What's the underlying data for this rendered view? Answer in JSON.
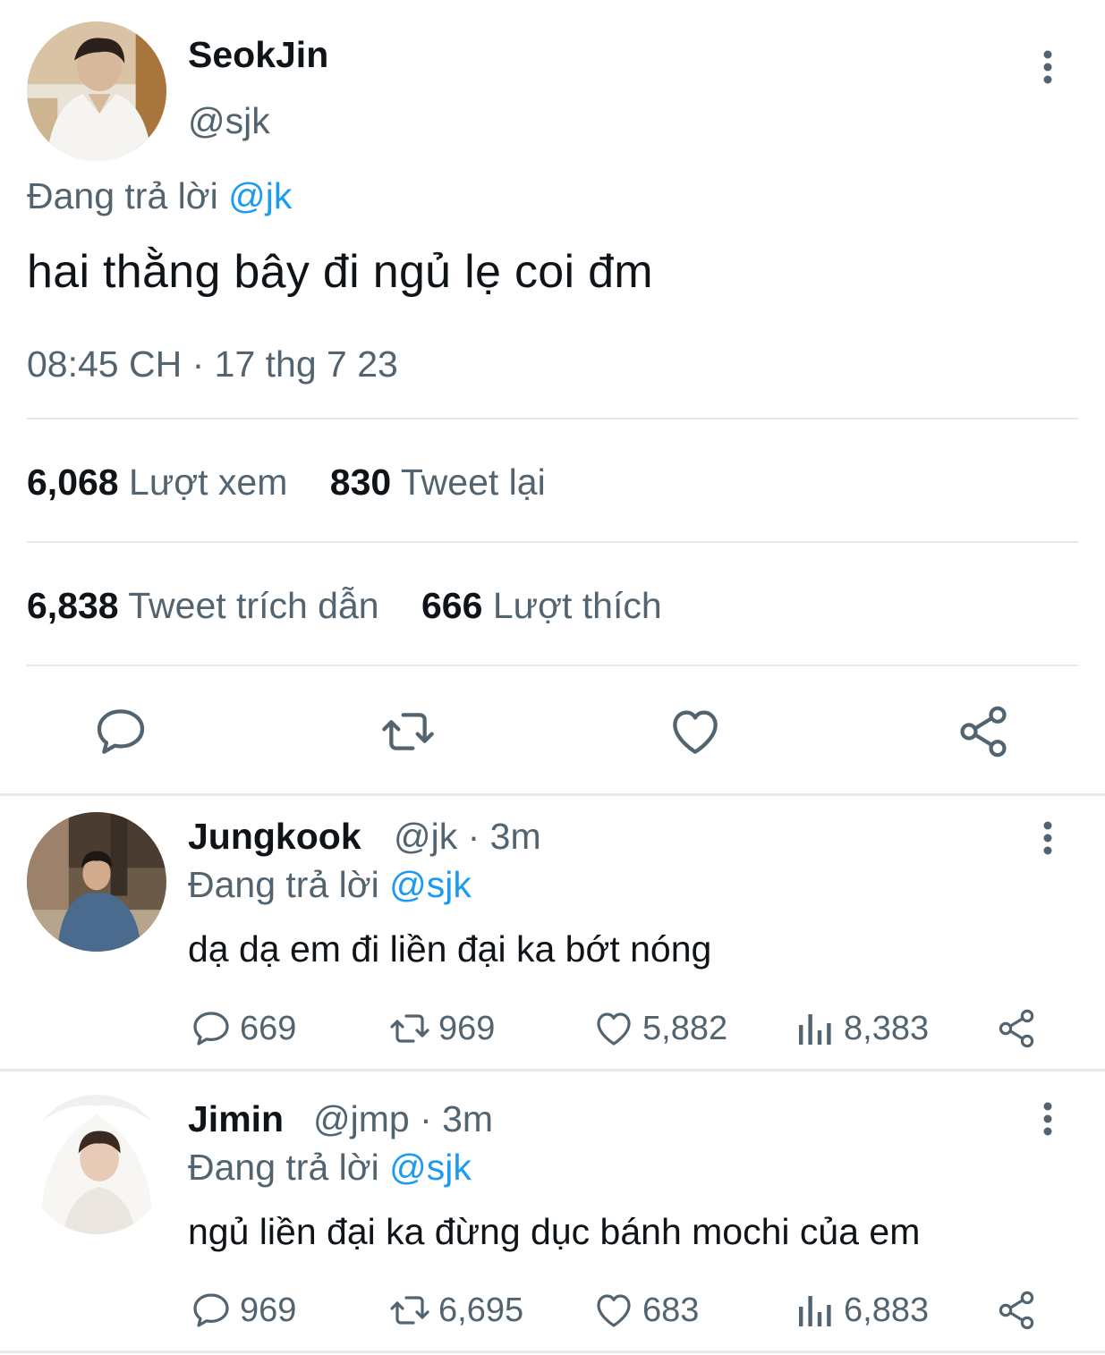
{
  "main_tweet": {
    "author": {
      "display_name": "SeokJin",
      "handle": "@sjk"
    },
    "reply_prefix": "Đang trả lời",
    "reply_to": "@jk",
    "text": "hai thằng bây đi ngủ lẹ coi đm",
    "timestamp": "08:45 CH · 17 thg 7 23",
    "stats": {
      "views_count": "6,068",
      "views_label": "Lượt xem",
      "retweets_count": "830",
      "retweets_label": "Tweet lại",
      "quotes_count": "6,838",
      "quotes_label": "Tweet trích dẫn",
      "likes_count": "666",
      "likes_label": "Lượt thích"
    },
    "actions": [
      "reply-icon",
      "retweet-icon",
      "like-icon",
      "share-icon"
    ]
  },
  "replies": [
    {
      "display_name": "Jungkook",
      "handle_time": "@jk · 3m",
      "reply_prefix": "Đang trả lời",
      "reply_to": "@sjk",
      "text": "dạ dạ em đi liền đại ka bớt nóng",
      "replies": "669",
      "retweets": "969",
      "likes": "5,882",
      "views": "8,383"
    },
    {
      "display_name": "Jimin",
      "handle_time": "@jmp · 3m",
      "reply_prefix": "Đang trả lời",
      "reply_to": "@sjk",
      "text": "ngủ liền đại ka đừng dục bánh mochi của em",
      "replies": "969",
      "retweets": "6,695",
      "likes": "683",
      "views": "6,883"
    }
  ],
  "colors": {
    "accent": "#1d9bf0",
    "text": "#0f1419",
    "muted": "#536471",
    "divider": "#e6e9eb"
  }
}
